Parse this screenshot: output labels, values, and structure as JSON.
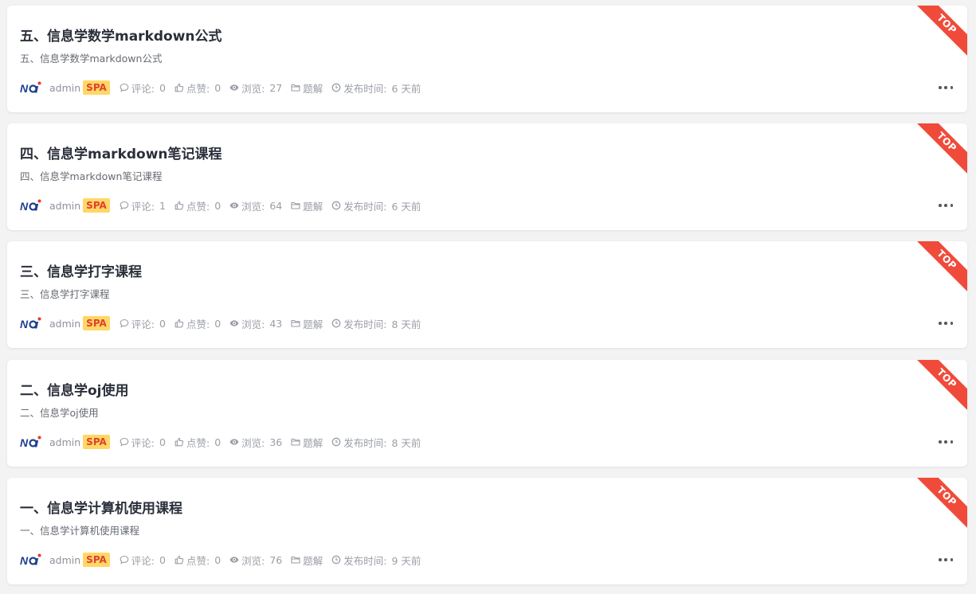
{
  "articles": [
    {
      "title": "五、信息学数学markdown公式",
      "summary": "五、信息学数学markdown公式",
      "author": "admin",
      "badge": "SPA",
      "comments_label": "评论:",
      "comments": "0",
      "likes_label": "点赞:",
      "likes": "0",
      "views_label": "浏览:",
      "views": "27",
      "category": "题解",
      "time_label": "发布时间:",
      "time": "6 天前",
      "ribbon": "TOP"
    },
    {
      "title": "四、信息学markdown笔记课程",
      "summary": "四、信息学markdown笔记课程",
      "author": "admin",
      "badge": "SPA",
      "comments_label": "评论:",
      "comments": "1",
      "likes_label": "点赞:",
      "likes": "0",
      "views_label": "浏览:",
      "views": "64",
      "category": "题解",
      "time_label": "发布时间:",
      "time": "6 天前",
      "ribbon": "TOP"
    },
    {
      "title": "三、信息学打字课程",
      "summary": "三、信息学打字课程",
      "author": "admin",
      "badge": "SPA",
      "comments_label": "评论:",
      "comments": "0",
      "likes_label": "点赞:",
      "likes": "0",
      "views_label": "浏览:",
      "views": "43",
      "category": "题解",
      "time_label": "发布时间:",
      "time": "8 天前",
      "ribbon": "TOP"
    },
    {
      "title": "二、信息学oj使用",
      "summary": "二、信息学oj使用",
      "author": "admin",
      "badge": "SPA",
      "comments_label": "评论:",
      "comments": "0",
      "likes_label": "点赞:",
      "likes": "0",
      "views_label": "浏览:",
      "views": "36",
      "category": "题解",
      "time_label": "发布时间:",
      "time": "8 天前",
      "ribbon": "TOP"
    },
    {
      "title": "一、信息学计算机使用课程",
      "summary": "一、信息学计算机使用课程",
      "author": "admin",
      "badge": "SPA",
      "comments_label": "评论:",
      "comments": "0",
      "likes_label": "点赞:",
      "likes": "0",
      "views_label": "浏览:",
      "views": "76",
      "category": "题解",
      "time_label": "发布时间:",
      "time": "9 天前",
      "ribbon": "TOP"
    }
  ],
  "icons": {
    "logo": "noi-logo",
    "comment": "comment-icon",
    "like": "thumbs-up-icon",
    "views": "eye-icon",
    "category": "folder-icon",
    "time": "clock-icon",
    "more": "more-dots-icon"
  },
  "colors": {
    "badge_bg": "#ffd766",
    "badge_text": "#e0402d",
    "ribbon": "#f04b3a",
    "title": "#2a2f3a"
  }
}
